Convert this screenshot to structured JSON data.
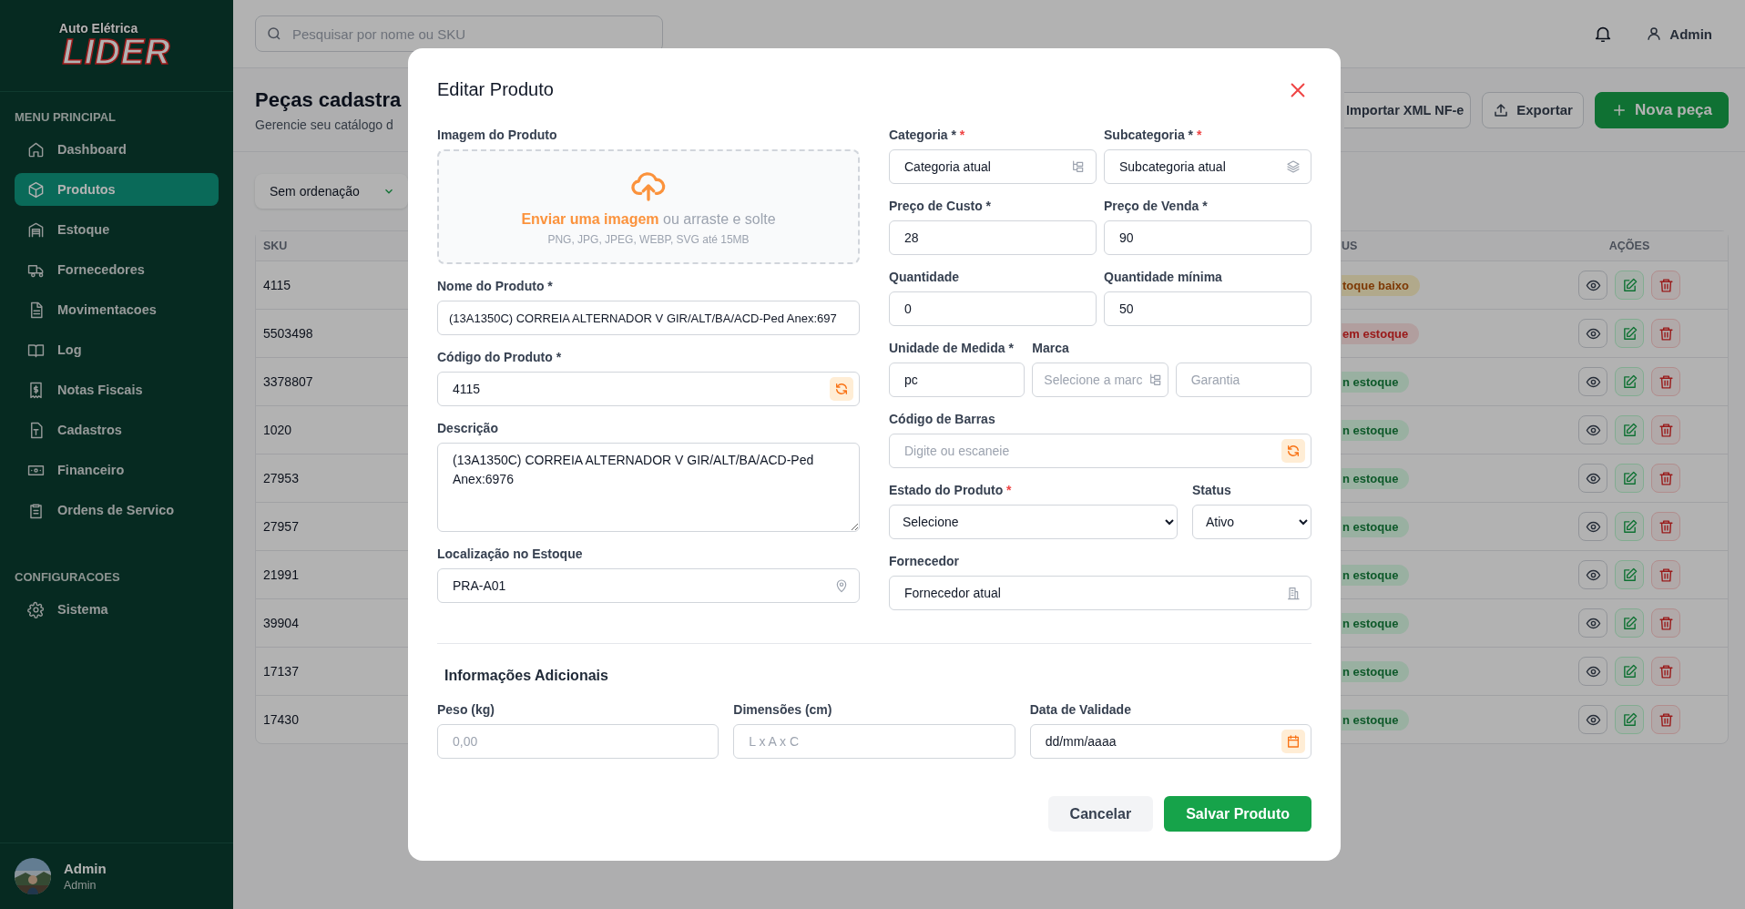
{
  "sidebar": {
    "logo": {
      "line_1": "Auto Elétrica",
      "line_2": "LIDER"
    },
    "sections": [
      {
        "title": "MENU PRINCIPAL",
        "items": [
          {
            "label": "Dashboard",
            "selected": false
          },
          {
            "label": "Produtos",
            "selected": true
          },
          {
            "label": "Estoque",
            "selected": false
          },
          {
            "label": "Fornecedores",
            "selected": false
          },
          {
            "label": "Movimentacoes",
            "selected": false
          },
          {
            "label": "Log",
            "selected": false
          },
          {
            "label": "Notas Fiscais",
            "selected": false
          },
          {
            "label": "Cadastros",
            "selected": false
          },
          {
            "label": "Financeiro",
            "selected": false
          },
          {
            "label": "Ordens de Servico",
            "selected": false
          }
        ]
      },
      {
        "title": "CONFIGURACOES",
        "items": [
          {
            "label": "Sistema",
            "selected": false
          }
        ]
      }
    ],
    "user": {
      "name": "Admin",
      "role": "Admin"
    }
  },
  "topbar": {
    "search": {
      "placeholder": "Pesquisar por nome ou SKU"
    },
    "user": "Admin"
  },
  "page": {
    "title": "Peças cadastra",
    "subtitle": "Gerencie seu catálogo d",
    "buttons": [
      {
        "label": "Importar XML NF-e",
        "kind": "partial"
      },
      {
        "label": "Exportar",
        "kind": "outline"
      },
      {
        "label": "Nova peça",
        "kind": "primary"
      }
    ],
    "sort": "Sem ordenação"
  },
  "table": {
    "columns": [
      "SKU",
      "US",
      "AÇÕES"
    ],
    "rows": [
      {
        "sku": "4115",
        "status": "toque baixo",
        "kind": "low"
      },
      {
        "sku": "5503498",
        "status": "em estoque",
        "kind": "out"
      },
      {
        "sku": "3378807",
        "status": "n estoque",
        "kind": "in"
      },
      {
        "sku": "1020",
        "status": "n estoque",
        "kind": "in"
      },
      {
        "sku": "27953",
        "status": "n estoque",
        "kind": "in"
      },
      {
        "sku": "27957",
        "status": "n estoque",
        "kind": "in"
      },
      {
        "sku": "21991",
        "status": "n estoque",
        "kind": "in"
      },
      {
        "sku": "39904",
        "status": "n estoque",
        "kind": "in"
      },
      {
        "sku": "17137",
        "status": "n estoque",
        "kind": "in"
      },
      {
        "sku": "17430",
        "status": "n estoque",
        "kind": "in"
      }
    ]
  },
  "modal": {
    "title": "Editar Produto",
    "image": {
      "label": "Imagem do Produto",
      "prompt": "**Enviar uma imagem** ou arraste e solte",
      "hint": "PNG, JPG, JPEG, WEBP, SVG até 15MB"
    },
    "name": {
      "label": "Nome do Produto *",
      "value": "(13A1350C) CORREIA ALTERNADOR V GIR/ALT/BA/ACD-Ped Anex:697"
    },
    "code": {
      "label": "Código do Produto *",
      "value": "4115"
    },
    "description": {
      "label": "Descrição",
      "value": "(13A1350C) CORREIA ALTERNADOR V GIR/ALT/BA/ACD-Ped Anex:6976"
    },
    "location": {
      "label": "Localização no Estoque",
      "value": "PRA-A01"
    },
    "category": {
      "label": "Categoria *",
      "required_mark": "*",
      "value": "Categoria atual"
    },
    "subcategory": {
      "label": "Subcategoria *",
      "required_mark": "*",
      "value": "Subcategoria atual"
    },
    "cost_price": {
      "label": "Preço de Custo *",
      "value": "28"
    },
    "sale_price": {
      "label": "Preço de Venda *",
      "value": "90"
    },
    "quantity": {
      "label": "Quantidade",
      "value": "0"
    },
    "min_quantity": {
      "label": "Quantidade mínima",
      "value": "50"
    },
    "unit": {
      "label": "Unidade de Medida *",
      "value": "pc"
    },
    "brand": {
      "label": "Marca",
      "placeholder": "Selecione a marc"
    },
    "warranty": {
      "placeholder": "Garantia"
    },
    "barcode": {
      "label": "Código de Barras",
      "placeholder": "Digite ou escaneie"
    },
    "condition": {
      "label": "Estado do Produto",
      "required_mark": "*",
      "value": "Selecione"
    },
    "status": {
      "label": "Status",
      "value": "Ativo"
    },
    "supplier": {
      "label": "Fornecedor",
      "value": "Fornecedor atual"
    },
    "extra_title": "Informações Adicionais",
    "weight": {
      "label": "Peso (kg)",
      "placeholder": "0,00"
    },
    "dimensions": {
      "label": "Dimensões (cm)",
      "placeholder": "L x A x C"
    },
    "expiry": {
      "label": "Data de Validade",
      "value": "dd/mm/aaaa"
    },
    "buttons": [
      {
        "label": "Cancelar",
        "kind": "secondary"
      },
      {
        "label": "Salvar Produto",
        "kind": "primary"
      }
    ]
  }
}
